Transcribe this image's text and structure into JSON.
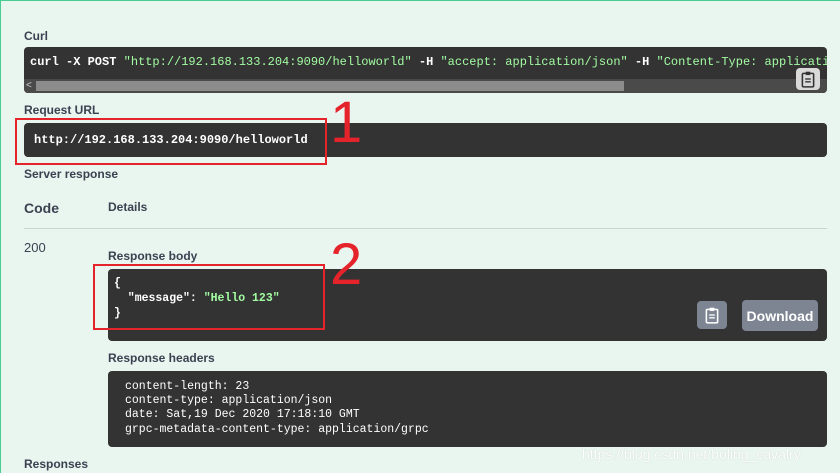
{
  "curl": {
    "label": "Curl",
    "cmd_prefix": "curl -X POST ",
    "url_str": "\"http://192.168.133.204:9090/helloworld\"",
    "opt1": " -H  ",
    "accept_str": "\"accept: application/json\"",
    "opt2": " -H  ",
    "ctype_str": "\"Content-Type: applicatio",
    "scroll_left_arrow": "<",
    "copy_icon": "clipboard-icon"
  },
  "request_url": {
    "label": "Request URL",
    "value": "http://192.168.133.204:9090/helloworld"
  },
  "server_response": {
    "label": "Server response",
    "col_code": "Code",
    "col_details": "Details",
    "code": "200",
    "body_label": "Response body",
    "body_line1": "{",
    "body_key": "  \"message\": ",
    "body_val": "\"Hello 123\"",
    "body_line3": "}",
    "copy_icon": "clipboard-icon",
    "download_label": "Download",
    "headers_label": "Response headers",
    "headers": [
      "content-length: 23",
      "content-type: application/json",
      "date: Sat,19 Dec 2020 17:18:10 GMT",
      "grpc-metadata-content-type: application/grpc"
    ]
  },
  "responses_label": "Responses",
  "annotations": {
    "num1": "1",
    "num2": "2",
    "color": "#e5232b"
  },
  "watermark": "https://blog.csdn.net/boling_cavalry",
  "colors": {
    "background": "#e9f6ef",
    "code_bg": "#333333",
    "string_green": "#a2fca2",
    "button_gray": "#7d8492",
    "border_green": "#49cc90"
  }
}
